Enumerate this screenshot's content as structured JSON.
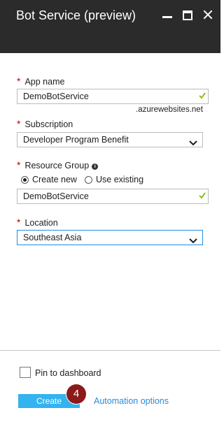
{
  "window": {
    "title": "Bot Service (preview)"
  },
  "form": {
    "app_name": {
      "label": "App name",
      "value": "DemoBotService",
      "suffix": ".azurewebsites.net"
    },
    "subscription": {
      "label": "Subscription",
      "value": "Developer Program Benefit"
    },
    "resource_group": {
      "label": "Resource Group",
      "option_create_new": "Create new",
      "option_use_existing": "Use existing",
      "selected_option": "Create new",
      "value": "DemoBotService"
    },
    "location": {
      "label": "Location",
      "value": "Southeast Asia"
    },
    "required_marker": "*",
    "info_glyph": "i"
  },
  "footer": {
    "pin_label": "Pin to dashboard",
    "pin_checked": false,
    "create_label": "Create",
    "step_number": "4",
    "automation_label": "Automation options"
  },
  "colors": {
    "titlebar": "#2b2b2b",
    "create_button": "#33b3f0",
    "link": "#2a8ad7",
    "valid_check": "#7fba00",
    "step_badge": "#8b1a1a",
    "required": "#c40000"
  },
  "icons": {
    "minimize": "minimize-icon",
    "maximize": "maximize-icon",
    "close": "close-icon",
    "valid": "checkmark-icon",
    "dropdown": "chevron-down-icon",
    "info": "info-icon"
  }
}
